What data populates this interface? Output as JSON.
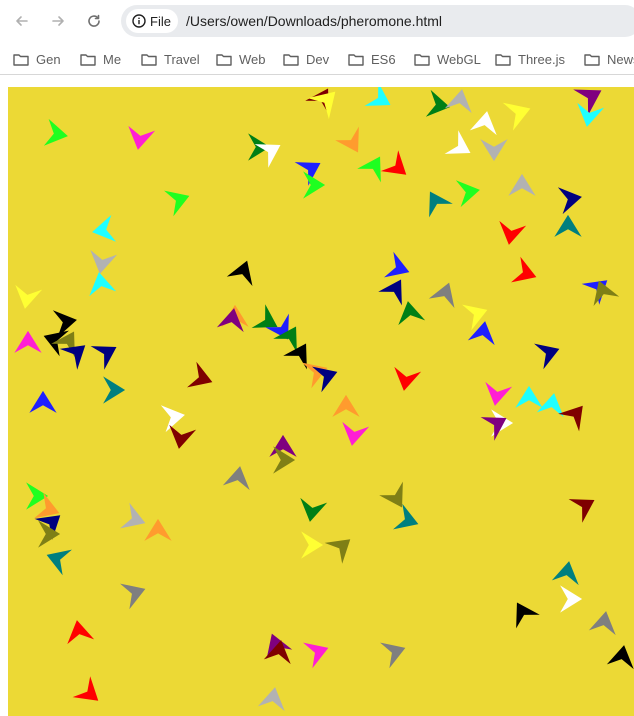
{
  "browser": {
    "site_chip_label": "File",
    "url": "/Users/owen/Downloads/pheromone.html",
    "bookmarks": [
      "Gen",
      "Me",
      "Travel",
      "Web",
      "Dev",
      "ES6",
      "WebGL",
      "Three.js",
      "News"
    ]
  },
  "canvas": {
    "background": "#ecd935",
    "agent_colors": {
      "green": "#1fff20",
      "magenta": "#ff1fd4",
      "yellow": "#ffff33",
      "cyan": "#1fffff",
      "maroon": "#7f0000",
      "darkgreen": "#007f16",
      "teal": "#007f7f",
      "blue": "#1f1fff",
      "navy": "#00007f",
      "red": "#ff0000",
      "orange": "#ff9b2e",
      "purple": "#7f007f",
      "olive": "#7f7f16",
      "gray": "#7f7f7f",
      "silver": "#b2b2b2",
      "white": "#ffffff",
      "black": "#000000"
    }
  }
}
